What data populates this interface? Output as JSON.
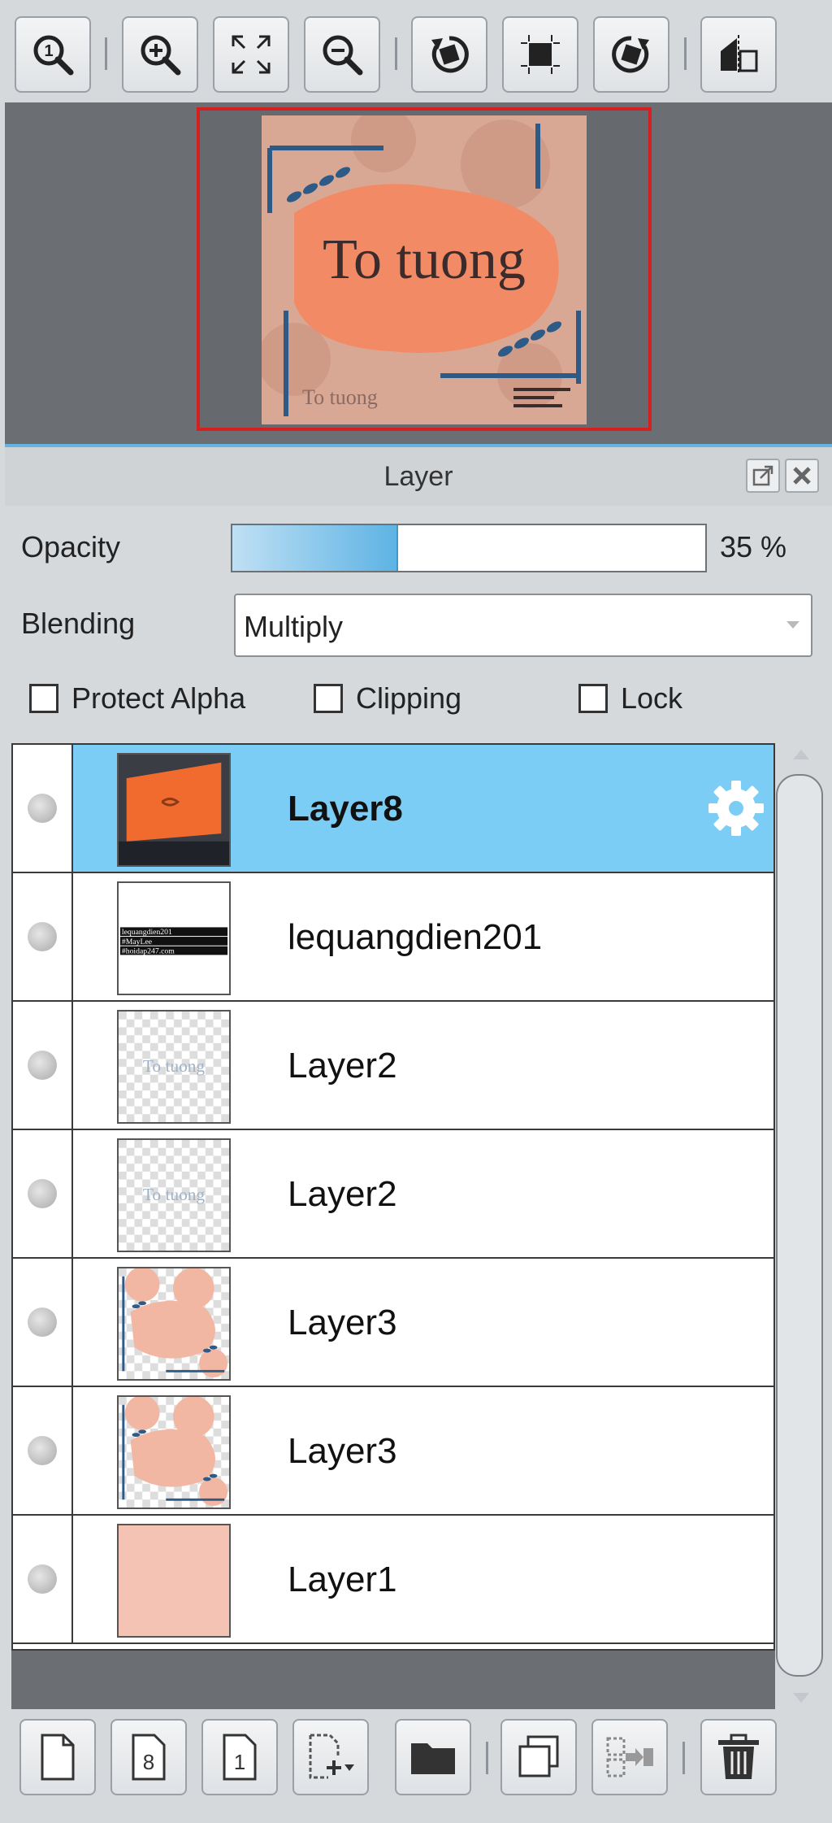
{
  "toolbar": {
    "buttons": [
      {
        "name": "zoom-actual-size-icon"
      },
      {
        "name": "zoom-in-icon"
      },
      {
        "name": "fit-to-screen-icon"
      },
      {
        "name": "zoom-out-icon"
      },
      {
        "name": "rotate-left-icon"
      },
      {
        "name": "reset-view-icon"
      },
      {
        "name": "rotate-right-icon"
      },
      {
        "name": "flip-horizontal-icon"
      }
    ]
  },
  "navigator": {
    "preview_title": "To tuong",
    "preview_small": "To tuong"
  },
  "panel": {
    "title": "Layer"
  },
  "properties": {
    "opacity_label": "Opacity",
    "opacity_percent": 35,
    "opacity_text": "35 %",
    "blending_label": "Blending",
    "blending_value": "Multiply",
    "protect_alpha_label": "Protect Alpha",
    "clipping_label": "Clipping",
    "lock_label": "Lock"
  },
  "layers": [
    {
      "name": "Layer8",
      "selected": true,
      "thumb": "orange-screen"
    },
    {
      "name": "lequangdien201",
      "selected": false,
      "thumb": "text-label",
      "thumb_lines": [
        "lequangdien201",
        "#MayLee",
        "#hoidap247.com"
      ]
    },
    {
      "name": "Layer2",
      "selected": false,
      "thumb": "faded-text",
      "thumb_text": "To tuong"
    },
    {
      "name": "Layer2",
      "selected": false,
      "thumb": "faded-text",
      "thumb_text": "To tuong"
    },
    {
      "name": "Layer3",
      "selected": false,
      "thumb": "peach-shapes"
    },
    {
      "name": "Layer3",
      "selected": false,
      "thumb": "peach-shapes"
    },
    {
      "name": "Layer1",
      "selected": false,
      "thumb": "solid-peach"
    }
  ],
  "bottom_toolbar": {
    "buttons": [
      {
        "name": "new-layer-icon"
      },
      {
        "name": "new-8bit-layer-icon",
        "label": "8"
      },
      {
        "name": "new-1bit-layer-icon",
        "label": "1"
      },
      {
        "name": "add-layer-dropdown-icon"
      },
      {
        "name": "folder-icon"
      },
      {
        "name": "duplicate-layer-icon"
      },
      {
        "name": "merge-layer-icon"
      },
      {
        "name": "delete-layer-icon"
      }
    ]
  },
  "colors": {
    "selection": "#7ccdf5",
    "navigator_frame": "#d42020",
    "accent_blue": "#2d5a86",
    "peach": "#f5c3b3",
    "orange": "#f8835a"
  }
}
